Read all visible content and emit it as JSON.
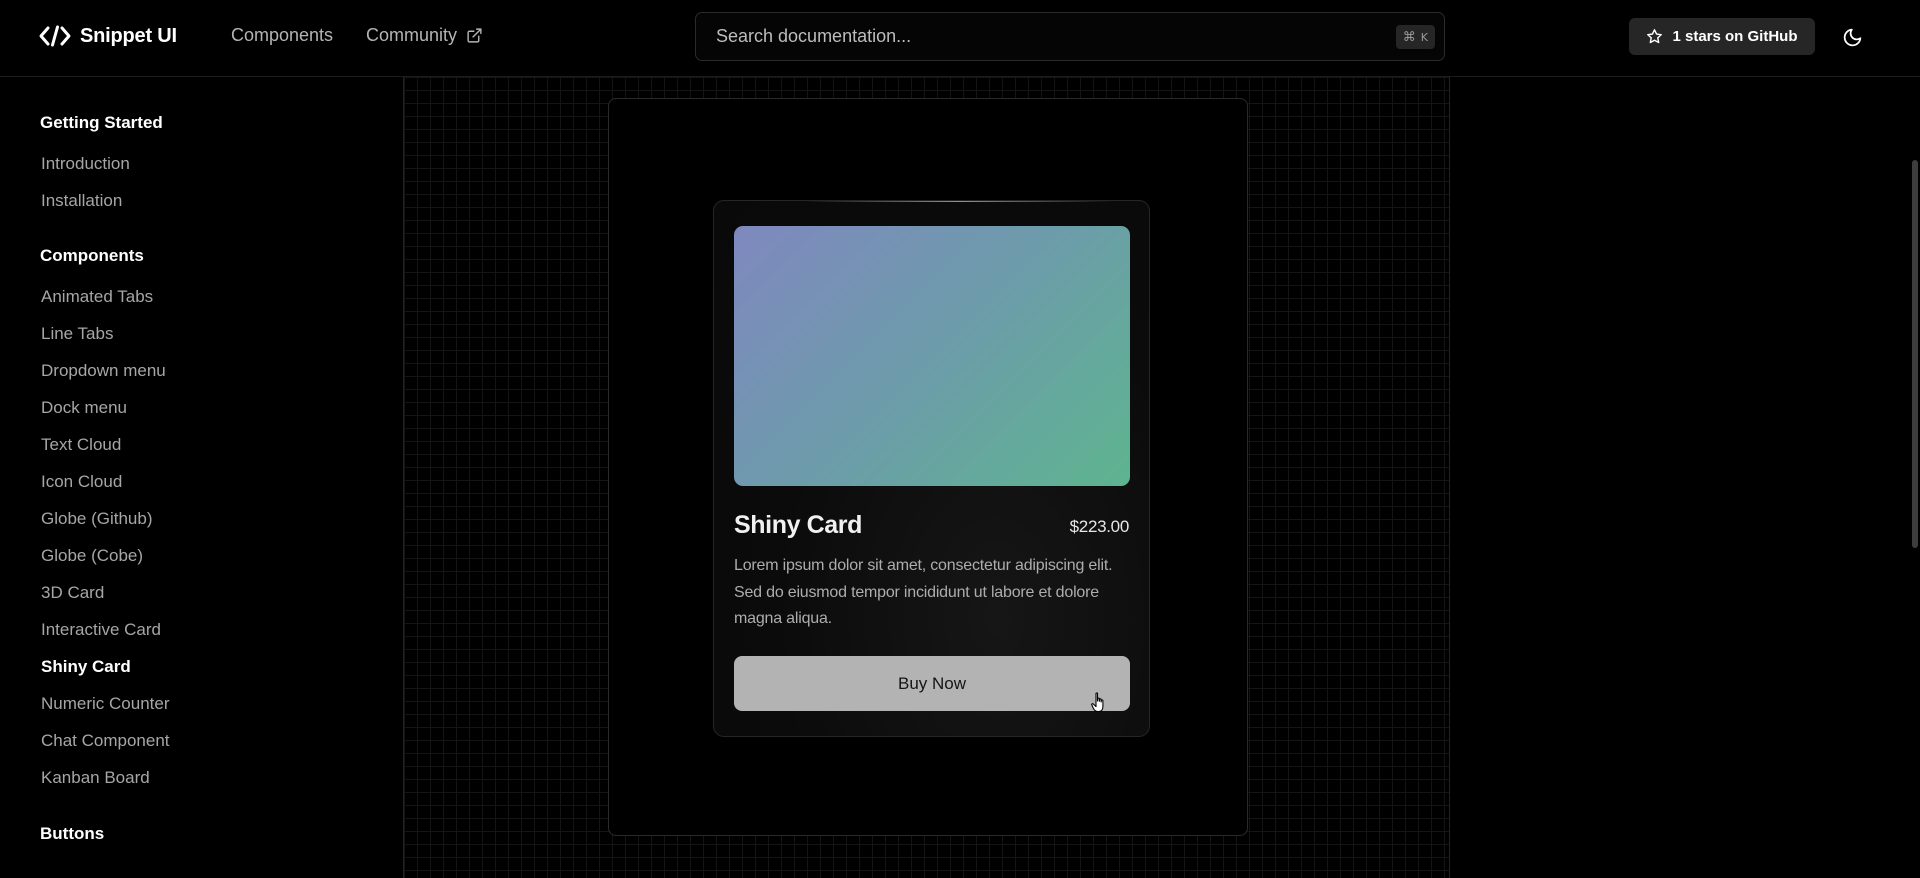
{
  "header": {
    "brand": "Snippet UI",
    "nav": [
      {
        "label": "Components",
        "external": false
      },
      {
        "label": "Community",
        "external": true
      }
    ],
    "search": {
      "placeholder": "Search documentation...",
      "shortcut_mod": "⌘",
      "shortcut_key": "K"
    },
    "github_button": "1 stars on GitHub",
    "theme_toggle_icon": "moon-icon"
  },
  "sidebar": {
    "sections": [
      {
        "title": "Getting Started",
        "items": [
          "Introduction",
          "Installation"
        ]
      },
      {
        "title": "Components",
        "items": [
          "Animated Tabs",
          "Line Tabs",
          "Dropdown menu",
          "Dock menu",
          "Text Cloud",
          "Icon Cloud",
          "Globe (Github)",
          "Globe (Cobe)",
          "3D Card",
          "Interactive Card",
          "Shiny Card",
          "Numeric Counter",
          "Chat Component",
          "Kanban Board"
        ]
      },
      {
        "title": "Buttons",
        "items": []
      }
    ],
    "active_item": "Shiny Card"
  },
  "card": {
    "title": "Shiny Card",
    "price": "$223.00",
    "description": "Lorem ipsum dolor sit amet, consectetur adipiscing elit. Sed do eiusmod tempor incididunt ut labore et dolore magna aliqua.",
    "button": "Buy Now",
    "image_gradient": [
      "#7f88bf",
      "#6c9caa",
      "#5eb48f"
    ]
  },
  "colors": {
    "background": "#000000",
    "border": "#2a2a2a",
    "muted_text": "#a6a6a6",
    "button_bg": "#b3b3b3"
  }
}
